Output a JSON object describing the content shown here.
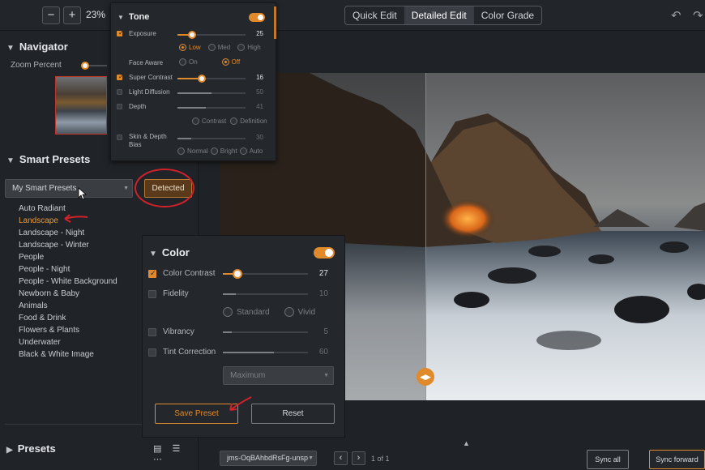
{
  "toolbar": {
    "zoom_out": "−",
    "zoom_in": "+",
    "zoom_value": "23%",
    "modes": [
      "Quick Edit",
      "Detailed Edit",
      "Color Grade"
    ],
    "active_mode": "Detailed Edit",
    "undo_icon": "↶",
    "redo_icon": "↷"
  },
  "navigator": {
    "title": "Navigator",
    "zoom_label": "Zoom Percent"
  },
  "smart_presets": {
    "title": "Smart Presets",
    "select_value": "My Smart Presets",
    "detected_label": "Detected",
    "items": [
      "Auto Radiant",
      "Landscape",
      "Landscape - Night",
      "Landscape - Winter",
      "People",
      "People - Night",
      "People - White Background",
      "Newborn & Baby",
      "Animals",
      "Food & Drink",
      "Flowers & Plants",
      "Underwater",
      "Black & White Image"
    ],
    "active_item": "Landscape"
  },
  "presets": {
    "title": "Presets",
    "view_icons": "▤ ☰ ⋯"
  },
  "tone": {
    "title": "Tone",
    "enabled": true,
    "exposure": {
      "label": "Exposure",
      "value": "25",
      "level": 0.22,
      "checked": true
    },
    "exposure_options": [
      "Low",
      "Med",
      "High"
    ],
    "exposure_selected": "Low",
    "face_aware": {
      "label": "Face Aware",
      "options": [
        "On",
        "Off"
      ],
      "selected": "Off"
    },
    "super_contrast": {
      "label": "Super Contrast",
      "value": "16",
      "level": 0.36,
      "checked": true
    },
    "light_diffusion": {
      "label": "Light Diffusion",
      "value": "50",
      "level": 0.5,
      "checked": false
    },
    "depth": {
      "label": "Depth",
      "value": "41",
      "level": 0.42,
      "checked": false
    },
    "depth_options": [
      "Contrast",
      "Definition"
    ],
    "depth_selected": "Definition",
    "skin_depth_bias": {
      "label": "Skin & Depth Bias",
      "value": "30",
      "level": 0.2,
      "checked": false
    },
    "skin_options": [
      "Normal",
      "Bright",
      "Auto"
    ]
  },
  "color": {
    "title": "Color",
    "enabled": true,
    "color_contrast": {
      "label": "Color Contrast",
      "value": "27",
      "level": 0.17,
      "checked": true
    },
    "fidelity": {
      "label": "Fidelity",
      "value": "10",
      "level": 0.15,
      "checked": false
    },
    "fidelity_options": [
      "Standard",
      "Vivid"
    ],
    "fidelity_selected": "Vivid",
    "vibrancy": {
      "label": "Vibrancy",
      "value": "5",
      "level": 0.1,
      "checked": false
    },
    "tint_correction": {
      "label": "Tint Correction",
      "value": "60",
      "level": 0.6,
      "checked": false
    },
    "tint_select": "Maximum",
    "save_preset": "Save Preset",
    "reset": "Reset"
  },
  "bottom": {
    "file_name": "jms-OqBAhbdRsFg-unsp",
    "prev": "‹",
    "next": "›",
    "page_info": "1 of 1",
    "sync_all": "Sync all",
    "sync_forward": "Sync forward"
  },
  "colors": {
    "accent": "#e08a2c",
    "annotation_red": "#d0222a"
  }
}
